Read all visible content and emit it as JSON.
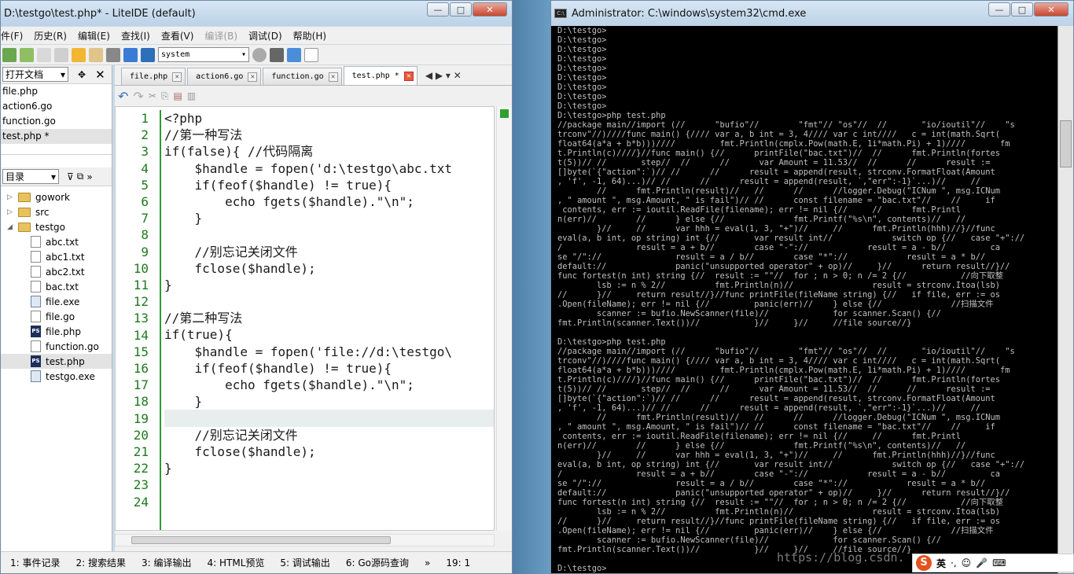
{
  "liteide": {
    "title": "D:\\testgo\\test.php* - LiteIDE (default)",
    "menu": [
      "件(F)",
      "历史(R)",
      "编辑(E)",
      "查找(I)",
      "查看(V)",
      "编译(B)",
      "调试(D)",
      "帮助(H)"
    ],
    "build_config": "system",
    "open_docs_label": "打开文档",
    "open_docs": [
      "file.php",
      "action6.go",
      "function.go",
      "test.php *"
    ],
    "dir_label": "目录",
    "tree": [
      {
        "name": "gowork",
        "type": "folder",
        "level": 0
      },
      {
        "name": "src",
        "type": "folder",
        "level": 0
      },
      {
        "name": "testgo",
        "type": "folder",
        "level": 0
      },
      {
        "name": "abc.txt",
        "type": "file",
        "level": 1
      },
      {
        "name": "abc1.txt",
        "type": "file",
        "level": 1
      },
      {
        "name": "abc2.txt",
        "type": "file",
        "level": 1
      },
      {
        "name": "bac.txt",
        "type": "file",
        "level": 1
      },
      {
        "name": "file.exe",
        "type": "exe",
        "level": 1
      },
      {
        "name": "file.go",
        "type": "file",
        "level": 1
      },
      {
        "name": "file.php",
        "type": "php",
        "level": 1
      },
      {
        "name": "function.go",
        "type": "file",
        "level": 1
      },
      {
        "name": "test.php",
        "type": "php",
        "level": 1
      },
      {
        "name": "testgo.exe",
        "type": "exe",
        "level": 1
      }
    ],
    "tabs": [
      "file.php",
      "action6.go",
      "function.go",
      "test.php *"
    ],
    "code_lines": [
      "<?php",
      "//第一种写法",
      "if(false){ //代码隔离",
      "    $handle = fopen('d:\\testgo\\abc.txt",
      "    if(feof($handle) != true){",
      "        echo fgets($handle).\"\\n\";",
      "    }",
      "",
      "    //别忘记关闭文件",
      "    fclose($handle);",
      "}",
      "",
      "//第二种写法",
      "if(true){",
      "    $handle = fopen('file://d:\\testgo\\",
      "    if(feof($handle) != true){",
      "        echo fgets($handle).\"\\n\";",
      "    }",
      "",
      "    //别忘记关闭文件",
      "    fclose($handle);",
      "}",
      "",
      ""
    ],
    "current_line": 19,
    "status_tabs": [
      "1: 事件记录",
      "2: 搜索结果",
      "3: 编译输出",
      "4: HTML预览",
      "5: 调试输出",
      "6: Go源码查询"
    ],
    "cursor_pos": "19: 1"
  },
  "cmd": {
    "title": "Administrator: C:\\windows\\system32\\cmd.exe",
    "lines": [
      "D:\\testgo>",
      "D:\\testgo>",
      "D:\\testgo>",
      "D:\\testgo>",
      "D:\\testgo>",
      "D:\\testgo>",
      "D:\\testgo>",
      "D:\\testgo>",
      "D:\\testgo>",
      "D:\\testgo>php test.php",
      "//package main//import (//      \"bufio\"//        \"fmt\"// \"os\"//  //       \"io/ioutil\"//    \"s",
      "trconv\"//)////func main() {//// var a, b int = 3, 4//// var c int////   c = int(math.Sqrt(",
      "float64(a*a + b*b)))////         fmt.Println(cmplx.Pow(math.E, 1i*math.Pi) + 1)////       fm",
      "t.Println(c)////}//func main() {//      printFile(\"bac.txt\")//  //      fmt.Println(fortes",
      "t(5))// //       step//  //      //      var Amount = 11.53//  //      //      result :=",
      "[]byte(`{\"action\":`)// //      //      result = append(result, strconv.FormatFloat(Amount",
      ", 'f', -1, 64)...)// //      //      result = append(result, `,\"err\":-1}`...)//     //",
      "        //      fmt.Println(result)//   //      //      //logger.Debug(\"ICNum \", msg.ICNum",
      ", \" amount \", msg.Amount, \" is fail\")// //      const filename = \"bac.txt\"//    //     if",
      " contents, err := ioutil.ReadFile(filename); err != nil {//     //      fmt.Printl",
      "n(err)//        //      } else {//              fmt.Printf(\"%s\\n\", contents)//   //",
      "        }//     //      var hhh = eval(1, 3, \"+\")//     //      fmt.Println(hhh)//}//func",
      "eval(a, b int, op string) int {//       var result int//            switch op {//   case \"+\"://",
      "/               result = a + b//        case \"-\"://            result = a - b//         ca",
      "se \"/\"://               result = a / b//        case \"*\"://            result = a * b//",
      "default://              panic(\"unsupported operator\" + op)//     }//      return result//}//",
      "func fortest(n int) string {//  result := \"\"//  for ; n > 0; n /= 2 {//           //向下取整",
      "        lsb := n % 2//          fmt.Println(n)//                result = strconv.Itoa(lsb)",
      "//      }//     return result//}//func printFile(fileName string) {//   if file, err := os",
      ".Open(fileName); err != nil {//         panic(err)//    } else {//              //扫描文件",
      "        scanner := bufio.NewScanner(file)//             for scanner.Scan() {//",
      "fmt.Println(scanner.Text())//           }//     }//     //file source//}",
      "",
      "D:\\testgo>php test.php",
      "//package main//import (//      \"bufio\"//        \"fmt\"// \"os\"//  //       \"io/ioutil\"//    \"s",
      "trconv\"//)////func main() {//// var a, b int = 3, 4//// var c int////   c = int(math.Sqrt(",
      "float64(a*a + b*b)))////         fmt.Println(cmplx.Pow(math.E, 1i*math.Pi) + 1)////       fm",
      "t.Println(c)////}//func main() {//      printFile(\"bac.txt\")//  //      fmt.Println(fortes",
      "t(5))// //       step//  //      //      var Amount = 11.53//  //      //      result :=",
      "[]byte(`{\"action\":`)// //      //      result = append(result, strconv.FormatFloat(Amount",
      ", 'f', -1, 64)...)// //      //      result = append(result, `,\"err\":-1}`...)//     //",
      "        //      fmt.Println(result)//   //      //      //logger.Debug(\"ICNum \", msg.ICNum",
      ", \" amount \", msg.Amount, \" is fail\")// //      const filename = \"bac.txt\"//    //     if",
      " contents, err := ioutil.ReadFile(filename); err != nil {//     //      fmt.Printl",
      "n(err)//        //      } else {//              fmt.Printf(\"%s\\n\", contents)//   //",
      "        }//     //      var hhh = eval(1, 3, \"+\")//     //      fmt.Println(hhh)//}//func",
      "eval(a, b int, op string) int {//       var result int//            switch op {//   case \"+\"://",
      "/               result = a + b//        case \"-\"://            result = a - b//         ca",
      "se \"/\"://               result = a / b//        case \"*\"://            result = a * b//",
      "default://              panic(\"unsupported operator\" + op)//     }//      return result//}//",
      "func fortest(n int) string {//  result := \"\"//  for ; n > 0; n /= 2 {//           //向下取整",
      "        lsb := n % 2//          fmt.Println(n)//                result = strconv.Itoa(lsb)",
      "//      }//     return result//}//func printFile(fileName string) {//   if file, err := os",
      ".Open(fileName); err != nil {//         panic(err)//    } else {//              //扫描文件",
      "        scanner := bufio.NewScanner(file)//             for scanner.Scan() {//",
      "fmt.Println(scanner.Text())//           }//     }//     //file source//}",
      "",
      "D:\\testgo>"
    ]
  },
  "watermark": "https://blog.csdn.",
  "ime_label": "英"
}
